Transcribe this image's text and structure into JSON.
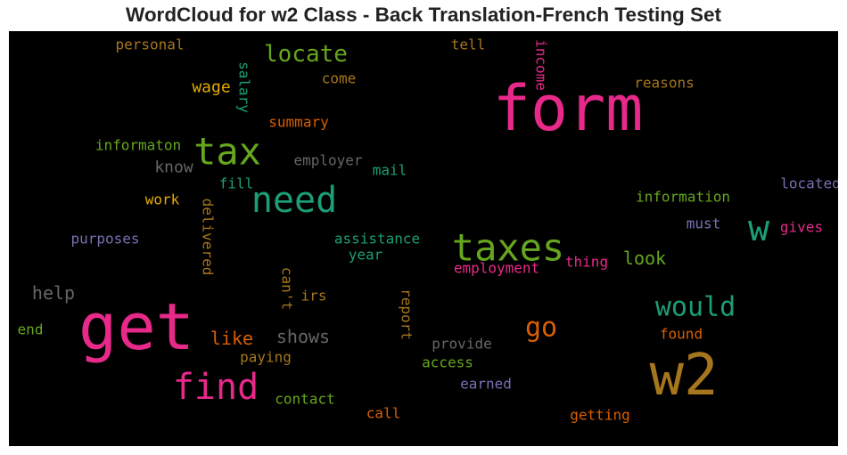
{
  "chart_data": {
    "type": "wordcloud",
    "title": "WordCloud for w2 Class - Back Translation-French Testing Set",
    "background": "#000000",
    "palette": {
      "magenta": "#e7298a",
      "green": "#66a61e",
      "teal": "#1b9e77",
      "orange": "#d95f02",
      "yellow": "#e6ab02",
      "brown": "#a6761d",
      "purple": "#7570b3",
      "gray": "#666666"
    },
    "words": [
      {
        "text": "form",
        "color": "magenta"
      },
      {
        "text": "get",
        "color": "magenta"
      },
      {
        "text": "w2",
        "color": "brown"
      },
      {
        "text": "taxes",
        "color": "green"
      },
      {
        "text": "tax",
        "color": "green"
      },
      {
        "text": "need",
        "color": "teal"
      },
      {
        "text": "find",
        "color": "magenta"
      },
      {
        "text": "w",
        "color": "teal"
      },
      {
        "text": "would",
        "color": "teal"
      },
      {
        "text": "go",
        "color": "orange"
      },
      {
        "text": "locate",
        "color": "green"
      },
      {
        "text": "shows",
        "color": "gray"
      },
      {
        "text": "like",
        "color": "orange"
      },
      {
        "text": "look",
        "color": "green"
      },
      {
        "text": "help",
        "color": "gray"
      },
      {
        "text": "know",
        "color": "gray"
      },
      {
        "text": "wage",
        "color": "yellow"
      },
      {
        "text": "personal",
        "color": "brown"
      },
      {
        "text": "tell",
        "color": "brown"
      },
      {
        "text": "income",
        "color": "magenta"
      },
      {
        "text": "reasons",
        "color": "brown"
      },
      {
        "text": "salary",
        "color": "teal"
      },
      {
        "text": "come",
        "color": "brown"
      },
      {
        "text": "summary",
        "color": "orange"
      },
      {
        "text": "informaton",
        "color": "green"
      },
      {
        "text": "employer",
        "color": "gray"
      },
      {
        "text": "mail",
        "color": "teal"
      },
      {
        "text": "fill",
        "color": "teal"
      },
      {
        "text": "work",
        "color": "yellow"
      },
      {
        "text": "delivered",
        "color": "brown"
      },
      {
        "text": "information",
        "color": "green"
      },
      {
        "text": "located",
        "color": "purple"
      },
      {
        "text": "must",
        "color": "purple"
      },
      {
        "text": "gives",
        "color": "magenta"
      },
      {
        "text": "purposes",
        "color": "purple"
      },
      {
        "text": "assistance",
        "color": "teal"
      },
      {
        "text": "year",
        "color": "teal"
      },
      {
        "text": "employment",
        "color": "magenta"
      },
      {
        "text": "thing",
        "color": "magenta"
      },
      {
        "text": "irs",
        "color": "brown"
      },
      {
        "text": "can't",
        "color": "brown"
      },
      {
        "text": "report",
        "color": "brown"
      },
      {
        "text": "provide",
        "color": "gray"
      },
      {
        "text": "end",
        "color": "green"
      },
      {
        "text": "paying",
        "color": "brown"
      },
      {
        "text": "access",
        "color": "green"
      },
      {
        "text": "found",
        "color": "orange"
      },
      {
        "text": "earned",
        "color": "purple"
      },
      {
        "text": "contact",
        "color": "green"
      },
      {
        "text": "call",
        "color": "orange"
      },
      {
        "text": "getting",
        "color": "orange"
      }
    ]
  }
}
